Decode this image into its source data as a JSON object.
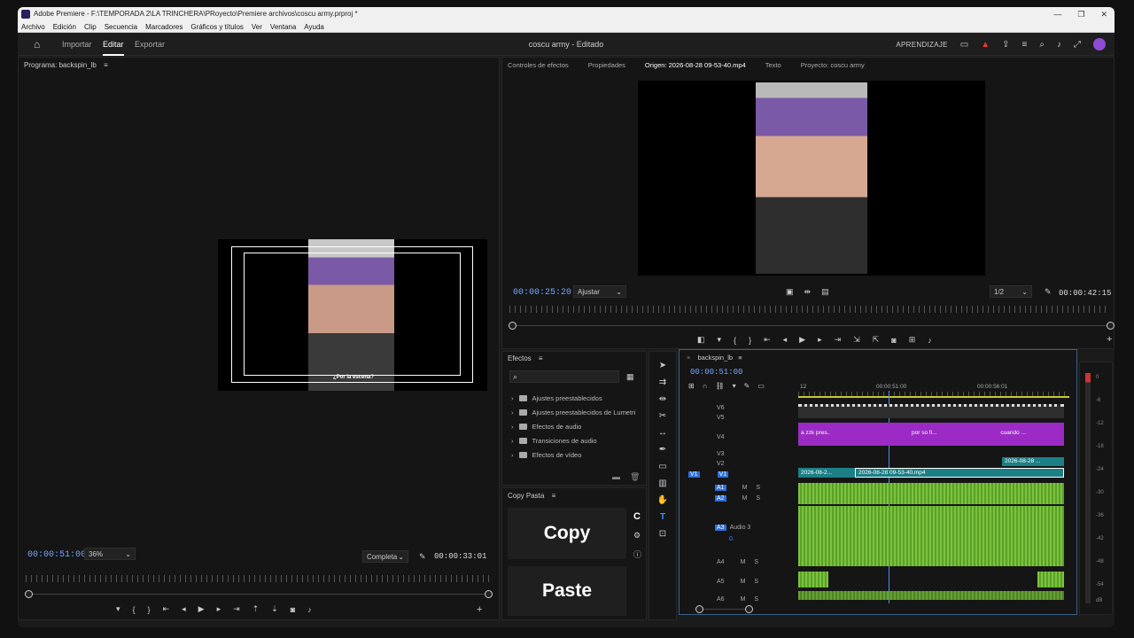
{
  "window": {
    "title": "Adobe Premiere - F:\\TEMPORADA 2\\LA TRINCHERA\\PRoyecto\\Premiere archivos\\coscu army.prproj *",
    "controls": [
      "—",
      "❐",
      "✕"
    ]
  },
  "menu": [
    "Archivo",
    "Edición",
    "Clip",
    "Secuencia",
    "Marcadores",
    "Gráficos y títulos",
    "Ver",
    "Ventana",
    "Ayuda"
  ],
  "appbar": {
    "tabs": [
      "Importar",
      "Editar",
      "Exportar"
    ],
    "active_tab": "Editar",
    "doc_title": "coscu army - Editado",
    "learn": "APRENDIZAJE"
  },
  "program_monitor": {
    "title": "Programa: backspin_lb",
    "timecode": "00:00:51:00",
    "zoom": "36%",
    "quality": "Completa",
    "duration": "00:00:33:01",
    "subtitle": "¿Por la escena?"
  },
  "source_panel": {
    "tabs": [
      "Controles de efectos",
      "Propiedades",
      "Origen: 2026-08-28 09-53-40.mp4",
      "Texto",
      "Proyecto: coscu army"
    ],
    "active_tab": "Origen: 2026-08-28 09-53-40.mp4",
    "timecode": "00:00:25:20",
    "fit": "Ajustar",
    "resolution": "1/2",
    "duration": "00:00:42:15"
  },
  "effects": {
    "title": "Efectos",
    "search_placeholder": "",
    "items": [
      "Ajustes preestablecidos",
      "Ajustes preestablecidos de Lumetri",
      "Efectos de audio",
      "Transiciones de audio",
      "Efectos de vídeo"
    ]
  },
  "copy_paste": {
    "title": "Copy Pasta",
    "copy_label": "Copy",
    "paste_label": "Paste",
    "icon_letter": "C"
  },
  "timeline": {
    "sequence": "backspin_lb",
    "timecode": "00:00:51:00",
    "ruler_labels": [
      "12",
      "00:00:51:00",
      "00:00:56:01"
    ],
    "video_tracks": [
      "V6",
      "V5",
      "V4",
      "V3",
      "V2",
      "V1"
    ],
    "audio_tracks": [
      "A1",
      "A2",
      "A3",
      "A4",
      "A5",
      "A6"
    ],
    "a3_name": "Audio 3",
    "a3_volume": "0.",
    "clips_v4": [
      "a zzk pres..",
      "por so fi...",
      "cuando ..."
    ],
    "clips_v2": "2026-08-28 ...",
    "clips_v1": [
      "2026-08-2...",
      "2026-08-28 09-53-40.mp4"
    ],
    "fx_label": "fx",
    "track_letters": {
      "mute": "M",
      "solo": "S"
    }
  },
  "vu_meter": {
    "labels": [
      "0",
      "-6",
      "-12",
      "-18",
      "-24",
      "-30",
      "-36",
      "-42",
      "-48",
      "-54",
      "dB"
    ]
  },
  "colors": {
    "accent": "#2f6fd6",
    "timecode": "#6fa8ff",
    "audio_clip": "#7dc33c",
    "video_clip_purple": "#9b2bc4",
    "video_clip_teal": "#1d7f86"
  }
}
